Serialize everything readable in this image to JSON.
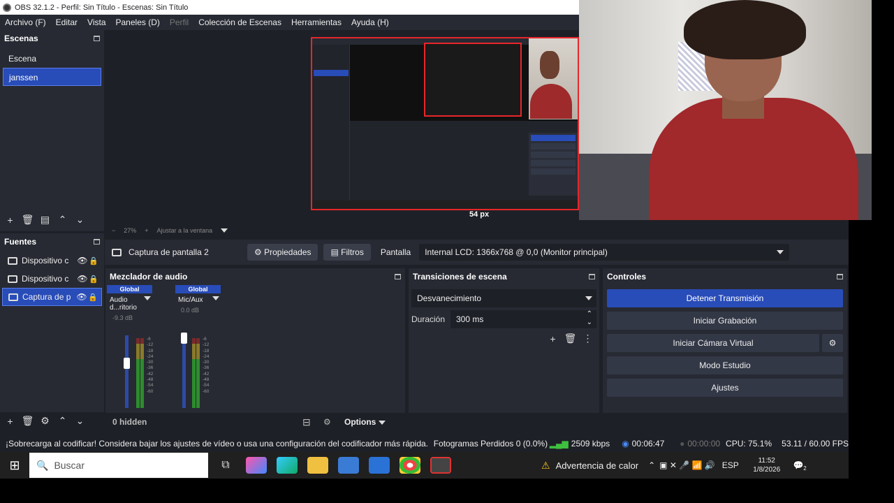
{
  "window": {
    "title": "OBS 32.1.2 - Perfil: Sin Título - Escenas: Sin Título"
  },
  "menu": [
    "Archivo (F)",
    "Editar",
    "Vista",
    "Paneles (D)",
    "Perfil",
    "Colección de Escenas",
    "Herramientas",
    "Ayuda (H)"
  ],
  "scenes": {
    "title": "Escenas",
    "items": [
      "Escena",
      "janssen"
    ],
    "selected": 1
  },
  "sources": {
    "title": "Fuentes",
    "items": [
      "Dispositivo c",
      "Dispositivo c",
      "Captura de p"
    ]
  },
  "preview": {
    "px_label": "54 px",
    "zoom": "27%",
    "fit_label": "Ajustar a la ventana"
  },
  "source_bar": {
    "source_name": "Captura de pantalla 2",
    "properties": "Propiedades",
    "filters": "Filtros",
    "display_label": "Pantalla",
    "display_value": "Internal LCD: 1366x768 @ 0,0 (Monitor principal)"
  },
  "mixer": {
    "title": "Mezclador de audio",
    "channels": [
      {
        "global": "Global",
        "name": "Audio d...ritorio",
        "db": "-9.3 dB",
        "level": 0.62
      },
      {
        "global": "Global",
        "name": "Mic/Aux",
        "db": "0.0 dB",
        "level": 0.96
      }
    ],
    "scale": [
      "-6",
      "-12",
      "-18",
      "-24",
      "-30",
      "-36",
      "-42",
      "-48",
      "-54",
      "-60"
    ],
    "hidden": "0 hidden",
    "options": "Options"
  },
  "transitions": {
    "title": "Transiciones de escena",
    "selected": "Desvanecimiento",
    "duration_label": "Duración",
    "duration_value": "300 ms"
  },
  "controls": {
    "title": "Controles",
    "stop_stream": "Detener Transmisión",
    "start_rec": "Iniciar Grabación",
    "virtual_cam": "Iniciar Cámara Virtual",
    "studio": "Modo Estudio",
    "settings": "Ajustes"
  },
  "status": {
    "warning": "¡Sobrecarga al codificar! Considera bajar los ajustes de vídeo o usa una configuración del codificador más rápida.",
    "dropped": "Fotogramas Perdidos 0 (0.0%)",
    "bitrate": "2509 kbps",
    "stream_time": "00:06:47",
    "rec_time": "00:00:00",
    "cpu": "CPU: 75.1%",
    "fps": "53.11 / 60.00 FPS"
  },
  "taskbar": {
    "search": "Buscar",
    "heat": "Advertencia de calor",
    "lang": "ESP",
    "time": "11:52",
    "date": "1/8/2026",
    "notif": "2"
  },
  "colors": {
    "accent": "#284cb8",
    "live_red": "#e8262a"
  }
}
